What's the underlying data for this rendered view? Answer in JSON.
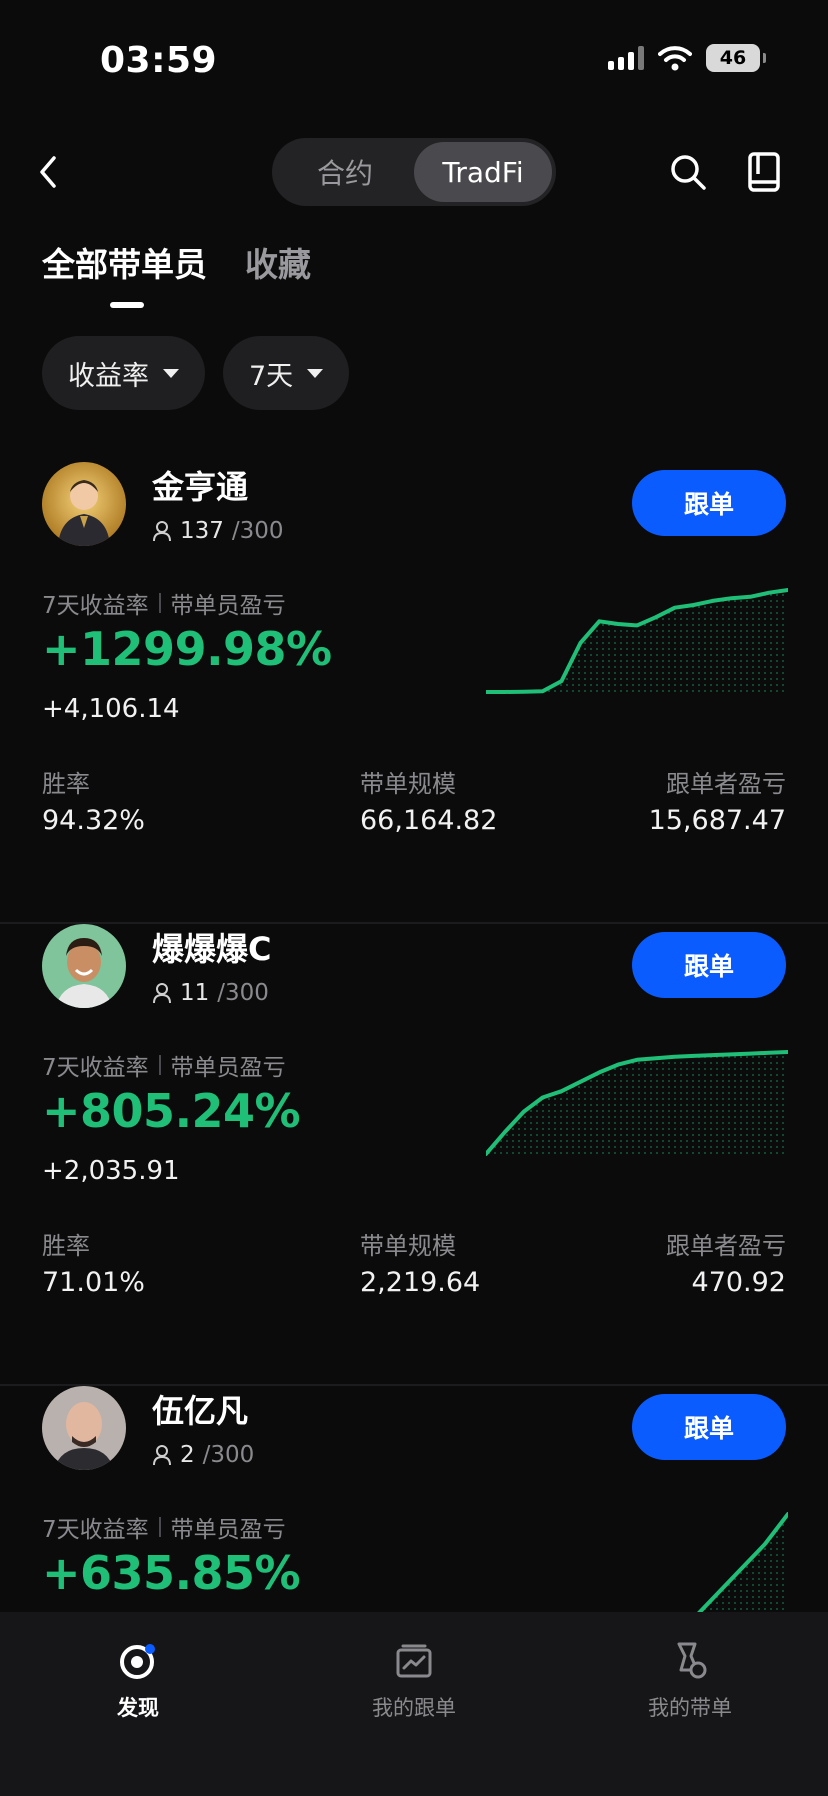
{
  "status_bar": {
    "time": "03:59",
    "battery": "46"
  },
  "header": {
    "segments": [
      {
        "label": "合约",
        "active": false
      },
      {
        "label": "TradFi",
        "active": true
      }
    ]
  },
  "tabs": [
    {
      "label": "全部带单员",
      "active": true
    },
    {
      "label": "收藏",
      "active": false
    }
  ],
  "filters": {
    "sort_label": "收益率",
    "period_label": "7天"
  },
  "colors": {
    "accent_green": "#1fbf77",
    "button_blue": "#0b5cff",
    "background": "#0b0b0c"
  },
  "labels": {
    "metric_roi": "7天收益率",
    "metric_pnl": "带单员盈亏",
    "win_rate": "胜率",
    "aum": "带单规模",
    "follower_pnl": "跟单者盈亏",
    "follow_button": "跟单"
  },
  "traders": [
    {
      "name": "金亨通",
      "followers": "137",
      "capacity": "/300",
      "roi": "+1299.98%",
      "pnl": "+4,106.14",
      "win_rate": "94.32%",
      "aum": "66,164.82",
      "follower_pnl": "15,687.47",
      "trend": [
        0,
        0,
        0.2,
        0.5,
        8,
        36,
        52,
        50,
        49,
        55,
        62,
        64,
        67,
        69,
        70,
        73,
        75
      ]
    },
    {
      "name": "爆爆爆C",
      "followers": "11",
      "capacity": "/300",
      "roi": "+805.24%",
      "pnl": "+2,035.91",
      "win_rate": "71.01%",
      "aum": "2,219.64",
      "follower_pnl": "470.92",
      "trend": [
        0,
        14,
        27,
        36,
        40,
        46,
        52,
        57,
        60,
        61,
        62,
        62.5,
        63,
        63.5,
        64,
        64.5,
        65
      ]
    },
    {
      "name": "伍亿凡",
      "followers": "2",
      "capacity": "/300",
      "roi": "+635.85%",
      "trend": [
        0,
        20,
        40,
        60,
        85
      ]
    }
  ],
  "bottom_nav": [
    {
      "label": "发现",
      "icon": "discover-icon",
      "active": true
    },
    {
      "label": "我的跟单",
      "icon": "my-copy-icon",
      "active": false
    },
    {
      "label": "我的带单",
      "icon": "my-lead-icon",
      "active": false
    }
  ]
}
